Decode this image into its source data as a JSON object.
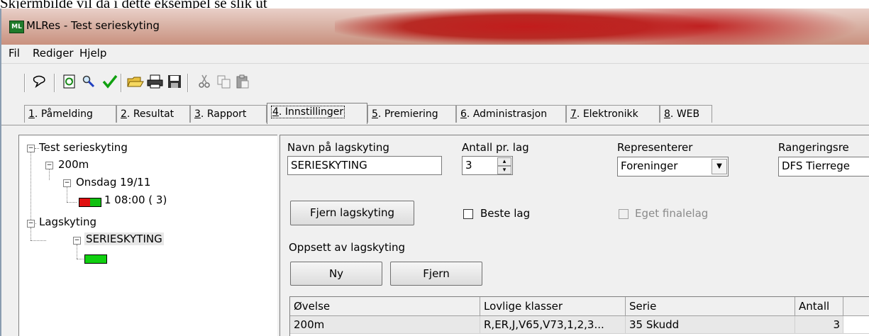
{
  "doc_text": "Skjermbilde vil da i dette eksempel se slik ut",
  "window": {
    "title": "MLRes - Test serieskyting",
    "app_icon_text": "ML",
    "titlebar_accent": "#c21c1c"
  },
  "menu": [
    "Fil",
    "Rediger",
    "Hjelp"
  ],
  "toolbar": {
    "icons": [
      "balloon-icon",
      "refresh-icon",
      "search-icon",
      "check-icon",
      "open-folder-icon",
      "print-icon",
      "save-icon",
      "cut-icon",
      "copy-icon",
      "paste-icon"
    ]
  },
  "tabs": [
    {
      "num": "1",
      "label": ". Påmelding"
    },
    {
      "num": "2",
      "label": ". Resultat"
    },
    {
      "num": "3",
      "label": ". Rapport"
    },
    {
      "num": "4",
      "label": ". Innstillinger"
    },
    {
      "num": "5",
      "label": ". Premiering"
    },
    {
      "num": "6",
      "label": ". Administrasjon"
    },
    {
      "num": "7",
      "label": ". Elektronikk"
    },
    {
      "num": "8",
      "label": ". WEB"
    }
  ],
  "active_tab": 3,
  "tree": {
    "root": "Test serieskyting",
    "distance": "200m",
    "day": "Onsdag 19/11",
    "relay": "1 08:00  ( 3)",
    "group": "Lagskyting",
    "team": "SERIESKYTING"
  },
  "form": {
    "name_label": "Navn på lagskyting",
    "name_value": "SERIESKYTING",
    "count_label": "Antall pr. lag",
    "count_value": "3",
    "represents_label": "Representerer",
    "represents_value": "Foreninger",
    "ranking_label": "Rangeringsre",
    "ranking_value": "DFS Tierrege",
    "remove_team_button": "Fjern lagskyting",
    "best_team_label": "Beste lag",
    "own_final_label": "Eget finalelag",
    "setup_label": "Oppsett av lagskyting",
    "new_button": "Ny",
    "remove_button": "Fjern"
  },
  "grid": {
    "headers": [
      "Øvelse",
      "Lovlige klasser",
      "Serie",
      "Antall"
    ],
    "rows": [
      {
        "ovelse": "200m",
        "klasser": "R,ER,J,V65,V73,1,2,3...",
        "serie": "35 Skudd",
        "antall": "3"
      }
    ]
  },
  "colors": {
    "relay_status_left": "#e01010",
    "relay_status_right": "#10c010",
    "team_status": "#10d010"
  }
}
